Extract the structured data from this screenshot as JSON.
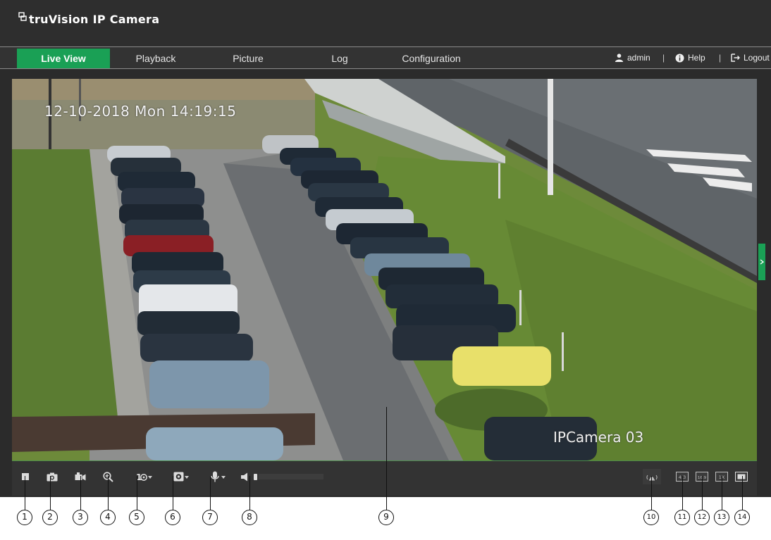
{
  "header": {
    "brand": "truVision",
    "product": "IP Camera"
  },
  "nav": {
    "tabs": [
      {
        "label": "Live View",
        "active": true
      },
      {
        "label": "Playback",
        "active": false
      },
      {
        "label": "Picture",
        "active": false
      },
      {
        "label": "Log",
        "active": false
      },
      {
        "label": "Configuration",
        "active": false
      }
    ],
    "user": "admin",
    "help": "Help",
    "logout": "Logout",
    "separator": "|"
  },
  "video": {
    "timestamp": "12-10-2018 Mon 14:19:15",
    "camera_name": "IPCamera 03"
  },
  "toolbar": {
    "left_icons": [
      "stop-icon",
      "camera-icon",
      "record-icon",
      "zoom-icon",
      "stream-icon",
      "image-icon",
      "microphone-icon",
      "volume-icon"
    ],
    "right_icons": [
      "alarm-icon",
      "ratio-4-3-icon",
      "ratio-16-9-icon",
      "original-size-icon",
      "fullscreen-icon"
    ],
    "ratio_labels": [
      "4:3",
      "16:9",
      "1X"
    ]
  },
  "callouts": [
    "1",
    "2",
    "3",
    "4",
    "5",
    "6",
    "7",
    "8",
    "9",
    "10",
    "11",
    "12",
    "13",
    "14"
  ],
  "colors": {
    "accent": "#1aa055",
    "background": "#2b2b2b"
  }
}
